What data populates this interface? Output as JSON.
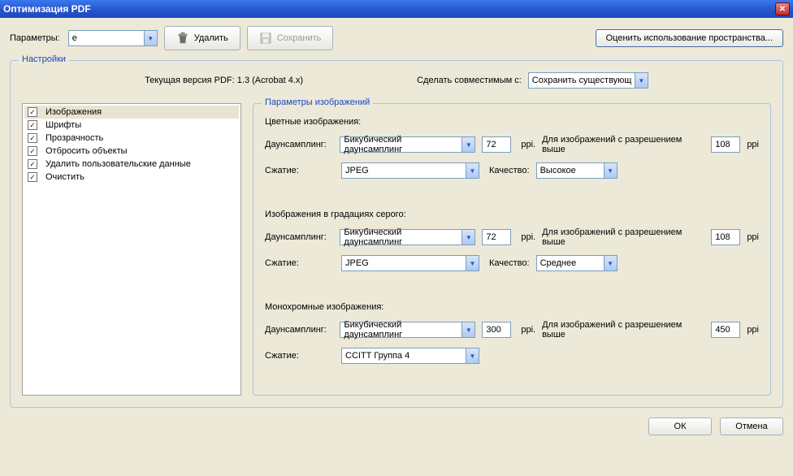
{
  "window": {
    "title": "Оптимизация PDF"
  },
  "toolbar": {
    "params_label": "Параметры:",
    "params_value": "e",
    "delete_label": "Удалить",
    "save_label": "Сохранить",
    "estimate_label": "Оценить использование пространства..."
  },
  "settings_fieldset_title": "Настройки",
  "version_row": {
    "current_label": "Текущая версия PDF: 1.3 (Acrobat 4.x)",
    "compat_label": "Сделать совместимым с:",
    "compat_value": "Сохранить существующ"
  },
  "nav": {
    "items": [
      {
        "label": "Изображения",
        "checked": true,
        "selected": true
      },
      {
        "label": "Шрифты",
        "checked": true,
        "selected": false
      },
      {
        "label": "Прозрачность",
        "checked": true,
        "selected": false
      },
      {
        "label": "Отбросить объекты",
        "checked": true,
        "selected": false
      },
      {
        "label": "Удалить пользовательские данные",
        "checked": true,
        "selected": false
      },
      {
        "label": "Очистить",
        "checked": true,
        "selected": false
      }
    ]
  },
  "images_fieldset_title": "Параметры изображений",
  "labels": {
    "downsampling": "Даунсамплинг:",
    "compression": "Сжатие:",
    "quality": "Качество:",
    "ppi1": "ppi.",
    "ppi2": "ppi",
    "above_res": "Для изображений с разрешением выше"
  },
  "sections": {
    "color": {
      "title": "Цветные изображения:",
      "downsampling": "Бикубический даунсамплинг",
      "compression": "JPEG",
      "quality": "Высокое",
      "dpi_target": "72",
      "dpi_above": "108"
    },
    "gray": {
      "title": "Изображения в градациях серого:",
      "downsampling": "Бикубический даунсамплинг",
      "compression": "JPEG",
      "quality": "Среднее",
      "dpi_target": "72",
      "dpi_above": "108"
    },
    "mono": {
      "title": "Монохромные изображения:",
      "downsampling": "Бикубический даунсамплинг",
      "compression": "CCITT Группа 4",
      "dpi_target": "300",
      "dpi_above": "450"
    }
  },
  "footer": {
    "ok": "ОК",
    "cancel": "Отмена"
  }
}
